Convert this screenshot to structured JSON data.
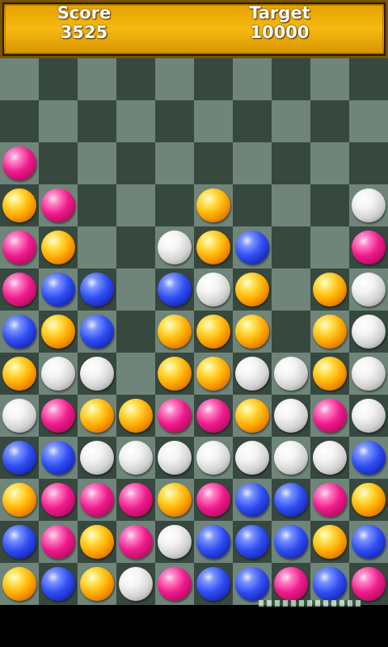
{
  "hud": {
    "score_label": "Score",
    "score_value": "3525",
    "target_label": "Target",
    "target_value": "10000"
  },
  "colors": {
    "pink": "#ef1b8b",
    "orange": "#ffb000",
    "blue": "#2f4ef2",
    "white": "#d2d2d2",
    "board_light": "#6f8579",
    "board_dark": "#37483f",
    "hud_gold": "#f3b10a"
  },
  "board": {
    "columns": 10,
    "rows": 13,
    "grid": [
      [
        null,
        null,
        null,
        null,
        null,
        null,
        null,
        null,
        null,
        null
      ],
      [
        null,
        null,
        null,
        null,
        null,
        null,
        null,
        null,
        null,
        null
      ],
      [
        "pink",
        null,
        null,
        null,
        null,
        null,
        null,
        null,
        null,
        null
      ],
      [
        "orange",
        "pink",
        null,
        null,
        null,
        "orange",
        null,
        null,
        null,
        "white"
      ],
      [
        "pink",
        "orange",
        null,
        null,
        "white",
        "orange",
        "blue",
        null,
        null,
        "pink"
      ],
      [
        "pink",
        "blue",
        "blue",
        null,
        "blue",
        "white",
        "orange",
        null,
        "orange",
        "white"
      ],
      [
        "blue",
        "orange",
        "blue",
        null,
        "orange",
        "orange",
        "orange",
        null,
        "orange",
        "white"
      ],
      [
        "orange",
        "white",
        "white",
        null,
        "orange",
        "orange",
        "white",
        "white",
        "orange",
        "white"
      ],
      [
        "white",
        "pink",
        "orange",
        "orange",
        "pink",
        "pink",
        "orange",
        "white",
        "pink",
        "white"
      ],
      [
        "blue",
        "blue",
        "white",
        "white",
        "white",
        "white",
        "white",
        "white",
        "white",
        "blue"
      ],
      [
        "orange",
        "pink",
        "pink",
        "pink",
        "orange",
        "pink",
        "blue",
        "blue",
        "pink",
        "orange"
      ],
      [
        "blue",
        "pink",
        "orange",
        "pink",
        "white",
        "blue",
        "blue",
        "blue",
        "orange",
        "blue"
      ],
      [
        "orange",
        "blue",
        "orange",
        "white",
        "pink",
        "blue",
        "blue",
        "pink",
        "blue",
        "pink"
      ]
    ]
  }
}
